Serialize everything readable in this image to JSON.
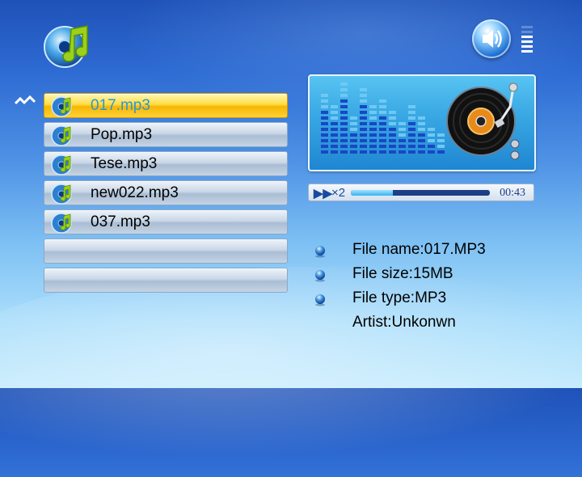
{
  "file_list": {
    "items": [
      {
        "label": "017.mp3",
        "selected": true
      },
      {
        "label": "Pop.mp3",
        "selected": false
      },
      {
        "label": "Tese.mp3",
        "selected": false
      },
      {
        "label": "new022.mp3",
        "selected": false
      },
      {
        "label": "037.mp3",
        "selected": false
      },
      {
        "label": "",
        "selected": false
      },
      {
        "label": "",
        "selected": false
      }
    ]
  },
  "playback": {
    "speed": "2",
    "time": "00:43",
    "progress_fraction": 0.3
  },
  "volume": {
    "level_fraction": 0.67
  },
  "file_info": {
    "name": "File name:017.MP3",
    "size": "File size:15MB",
    "type": "File type:MP3",
    "artist": "Artist:Unkonwn"
  },
  "colors": {
    "selected_row": "#ffd23a",
    "selected_text": "#2b97d8",
    "accent_blue": "#1a4aa0"
  },
  "icons": {
    "logo": "music-note-disc-icon",
    "volume": "speaker-icon",
    "scroll": "scroll-up-icon",
    "row": "music-disc-icon",
    "play_state": "fast-forward-icon",
    "speed_prefix": "×",
    "bullet": "sphere-bullet-icon"
  }
}
